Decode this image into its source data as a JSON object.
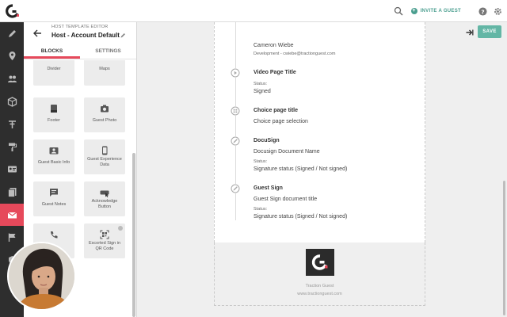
{
  "topbar": {
    "invite_label": "INVITE A GUEST"
  },
  "leftnav": {
    "items": [
      "pen-icon",
      "location-pin-icon",
      "people-icon",
      "cube-icon",
      "key-icon",
      "paint-roller-icon",
      "id-card-icon",
      "documents-icon",
      "mail-icon",
      "flag-icon",
      "shield-icon"
    ],
    "active_index": 8
  },
  "panel": {
    "subheading": "HOST TEMPLATE EDITOR",
    "title": "Host - Account Default",
    "tabs": [
      {
        "label": "BLOCKS",
        "active": true
      },
      {
        "label": "SETTINGS",
        "active": false
      }
    ],
    "blocks": [
      {
        "label": "Divider",
        "icon": "divider-icon"
      },
      {
        "label": "Maps",
        "icon": "map-icon"
      },
      {
        "label": "Footer",
        "icon": "footer-icon"
      },
      {
        "label": "Guest Photo",
        "icon": "camera-icon"
      },
      {
        "label": "Guest Basic Info",
        "icon": "contact-card-icon"
      },
      {
        "label": "Guest Experience Data",
        "icon": "phone-icon"
      },
      {
        "label": "Guest Notes",
        "icon": "note-icon"
      },
      {
        "label": "Acknowledge Button",
        "icon": "button-icon"
      },
      {
        "label": "",
        "icon": "phone-call-icon"
      },
      {
        "label": "Escorted Sign in QR Code",
        "icon": "qr-code-icon"
      }
    ]
  },
  "canvas": {
    "save_label": "SAVE",
    "host": {
      "name": "Cameron Wiebe",
      "detail": "Development - cwiebe@tractionguest.com"
    },
    "items": [
      {
        "title": "Video Page Title",
        "status_label": "Status:",
        "value": "Signed",
        "icon": "play-icon"
      },
      {
        "title": "Choice page title",
        "value": "Choice page selection",
        "icon": "grid-icon"
      },
      {
        "title": "DocuSign",
        "value": "Docusign Document Name",
        "status_label": "Status:",
        "status": "Signature status (Signed / Not signed)",
        "icon": "signature-icon"
      },
      {
        "title": "Guest Sign",
        "value": "Guest Sign document title",
        "status_label": "Status:",
        "status": "Signature status (Signed / Not signed)",
        "icon": "signature-icon"
      }
    ],
    "footer": {
      "company": "Traction Guest",
      "site": "www.tractionguest.com"
    }
  },
  "colors": {
    "accent": "#e6495b",
    "save": "#63b6a5",
    "nav_bg": "#2e2e2e"
  }
}
